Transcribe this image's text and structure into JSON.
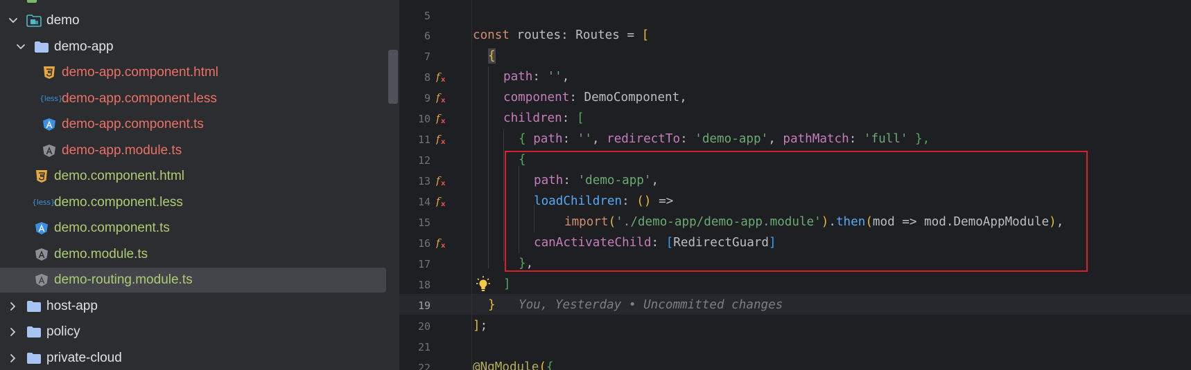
{
  "project_tree": {
    "items": [
      {
        "name": "demo",
        "kind": "folder-open-module"
      },
      {
        "name": "demo-app",
        "kind": "folder-open"
      },
      {
        "name": "demo-app.component.html",
        "kind": "html"
      },
      {
        "name": "demo-app.component.less",
        "kind": "less"
      },
      {
        "name": "demo-app.component.ts",
        "kind": "angular-component"
      },
      {
        "name": "demo-app.module.ts",
        "kind": "angular-module"
      },
      {
        "name": "demo.component.html",
        "kind": "html"
      },
      {
        "name": "demo.component.less",
        "kind": "less"
      },
      {
        "name": "demo.component.ts",
        "kind": "angular-component"
      },
      {
        "name": "demo.module.ts",
        "kind": "angular-module"
      },
      {
        "name": "demo-routing.module.ts",
        "kind": "angular-module",
        "selected": true
      },
      {
        "name": "host-app",
        "kind": "folder-closed"
      },
      {
        "name": "policy",
        "kind": "folder-closed"
      },
      {
        "name": "private-cloud",
        "kind": "folder-closed"
      }
    ],
    "less_icon_text": "{less}",
    "colors": {
      "folder": "#dfe1e5",
      "modified_new": "#eb7165",
      "modified": "#afcb73",
      "selection": "#43454a"
    }
  },
  "editor": {
    "line_numbers": [
      "5",
      "6",
      "7",
      "8",
      "9",
      "10",
      "11",
      "12",
      "13",
      "14",
      "15",
      "16",
      "17",
      "18",
      "19",
      "20",
      "21",
      "22"
    ],
    "current_line": "19",
    "gutter_icons": {
      "8": "angular-route-icon",
      "9": "angular-route-icon",
      "10": "angular-route-icon",
      "11": "angular-route-icon",
      "13": "angular-route-icon",
      "14": "angular-route-icon",
      "16": "angular-route-icon",
      "18": "lightbulb-icon"
    },
    "code": {
      "l6": {
        "kw": "const",
        "rest": " routes: Routes = ",
        "bracket": "["
      },
      "l7": {
        "brace": "{"
      },
      "l8": {
        "prop": "path",
        "colon": ": ",
        "str": "''",
        "tail": ","
      },
      "l9": {
        "prop": "component",
        "rest": ": DemoComponent,"
      },
      "l10": {
        "prop": "children",
        "colon": ": ",
        "bracket": "["
      },
      "l11": {
        "open": "{",
        "prop1": "path",
        "c1": ": ",
        "s1": "''",
        "sep1": ", ",
        "prop2": "redirectTo",
        "c2": ": ",
        "s2": "'demo-app'",
        "sep2": ", ",
        "prop3": "pathMatch",
        "c3": ": ",
        "s3": "'full'",
        "close": " },",
        "tail": ""
      },
      "l12": {
        "brace": "{"
      },
      "l13": {
        "prop": "path",
        "colon": ": ",
        "str": "'demo-app'",
        "tail": ","
      },
      "l14": {
        "prop": "loadChildren",
        "colon": ": ",
        "parens": "()",
        "arrow": " =>"
      },
      "l15": {
        "kw": "import",
        "p1": "(",
        "str": "'./demo-app/demo-app.module'",
        "p2": ")",
        "dot": ".",
        "fn": "then",
        "p3": "(",
        "body": "mod => mod.DemoAppModule",
        "p4": ")",
        "tail": ","
      },
      "l16": {
        "prop": "canActivateChild",
        "colon": ": ",
        "b_open": "[",
        "ident": "RedirectGuard",
        "b_close": "]"
      },
      "l17": {
        "brace": "}",
        "tail": ","
      },
      "l18": {
        "bracket": "]"
      },
      "l19": {
        "brace": "}",
        "annotation": "You, Yesterday • Uncommitted changes"
      },
      "l20": {
        "bracket": "]",
        "tail": ";"
      },
      "l22": {
        "decorator": "@NgModule",
        "p": "(",
        "brace": "{"
      }
    },
    "colors": {
      "keyword": "#cf8e6d",
      "property": "#c77dbb",
      "string": "#6aab73",
      "function": "#56a8f5",
      "bracket_level1": "#e8ba36",
      "bracket_level2": "#54a857",
      "bracket_level3": "#359ff4",
      "highlight_box": "#d5232c"
    }
  }
}
